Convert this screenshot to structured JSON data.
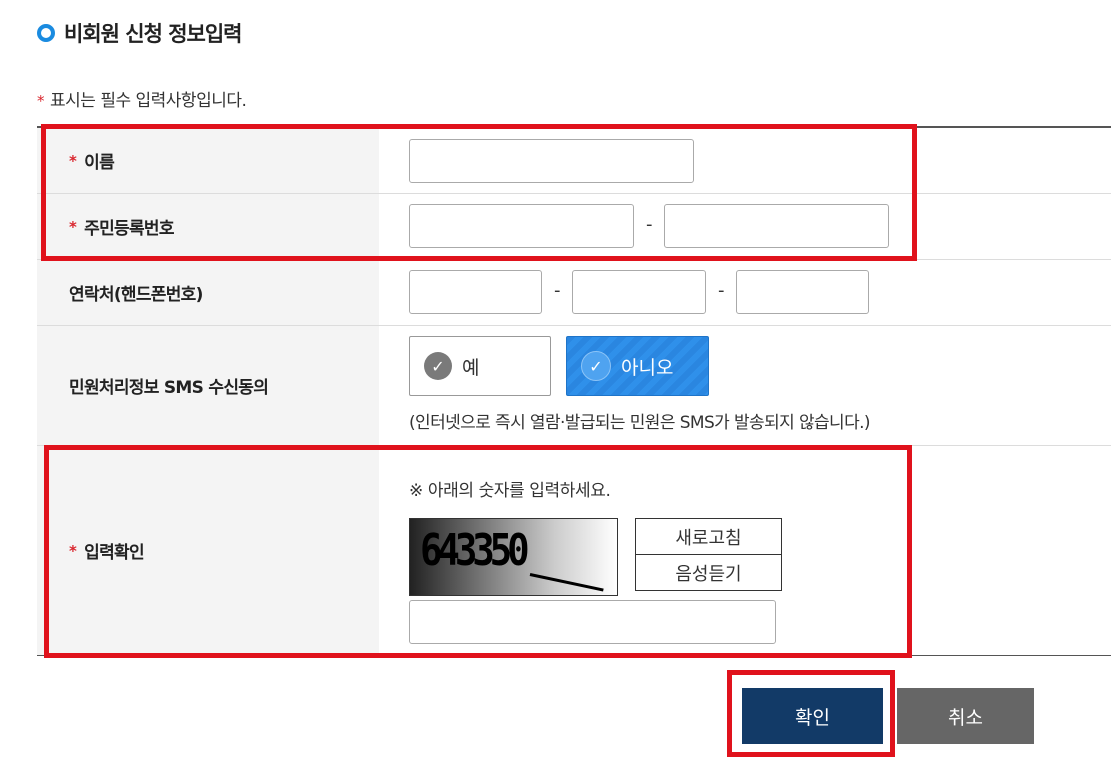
{
  "section_title": "비회원 신청 정보입력",
  "required_note": "표시는 필수 입력사항입니다.",
  "required_mark": "*",
  "fields": {
    "name_label": "이름",
    "rrn_label": "주민등록번호",
    "phone_label": "연락처(핸드폰번호)",
    "sms_label": "민원처리정보 SMS 수신동의",
    "captcha_label": "입력확인"
  },
  "dash": "-",
  "sms": {
    "yes_label": "예",
    "no_label": "아니오",
    "selected": "아니오",
    "note": "(인터넷으로 즉시 열람·발급되는 민원은 SMS가 발송되지 않습니다.)"
  },
  "captcha": {
    "instruction": "※ 아래의 숫자를 입력하세요.",
    "image_text": "643350",
    "refresh_label": "새로고침",
    "audio_label": "음성듣기"
  },
  "buttons": {
    "confirm_label": "확인",
    "cancel_label": "취소"
  },
  "colors": {
    "highlight": "#e0121c",
    "confirm_bg": "#123a67",
    "cancel_bg": "#666666",
    "selected_radio": "#2a86e0",
    "required_star": "#d9262e"
  },
  "icons": {
    "title_bullet": "circle-bullet-icon",
    "check": "checkmark-icon"
  }
}
